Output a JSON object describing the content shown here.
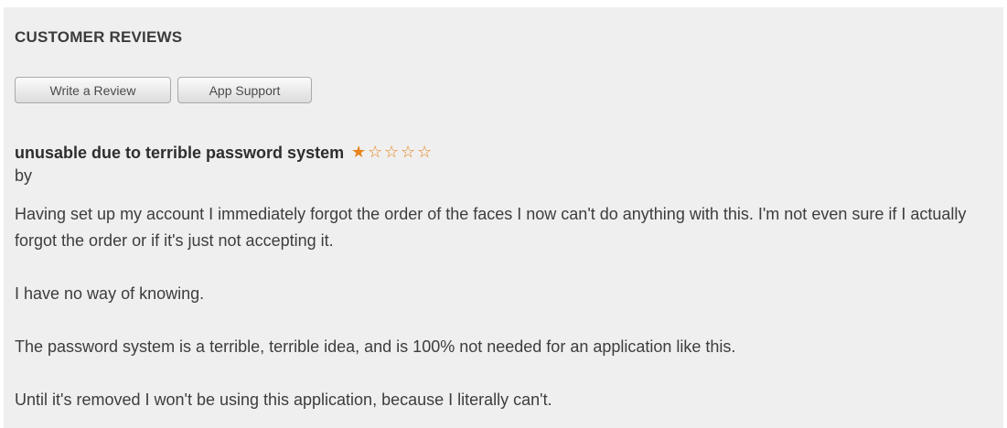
{
  "section": {
    "title": "CUSTOMER REVIEWS"
  },
  "buttons": {
    "write_review": "Write a Review",
    "app_support": "App Support"
  },
  "review": {
    "title": "unusable due to terrible password system",
    "rating": 1,
    "rating_max": 5,
    "star_filled": "★",
    "star_empty": "☆",
    "byline": "by",
    "paragraphs": [
      "Having set up my account I immediately forgot the order of the faces I now can't do anything with this. I'm not even sure if I actually forgot the order or if it's just not accepting it.",
      "I have no way of knowing.",
      "The password system is a terrible, terrible idea, and is 100% not needed for an application like this.",
      "Until it's removed I won't be using this application, because I literally can't."
    ]
  },
  "colors": {
    "panel_background": "#efefef",
    "star_color": "#e8841c",
    "text_color": "#3d3d3d"
  }
}
